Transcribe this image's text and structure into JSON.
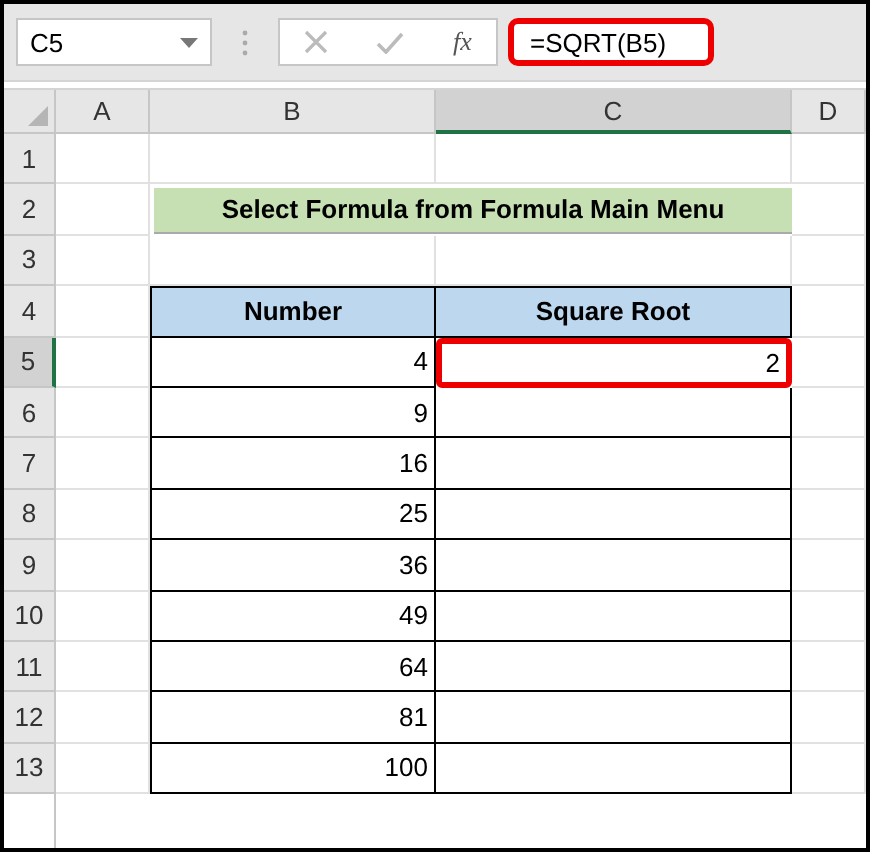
{
  "formula_bar": {
    "name_box": "C5",
    "function_label": "fx",
    "formula": "=SQRT(B5)",
    "highlighted": true
  },
  "columns": [
    {
      "label": "A",
      "selected": false
    },
    {
      "label": "B",
      "selected": false
    },
    {
      "label": "C",
      "selected": true
    },
    {
      "label": "D",
      "selected": false
    }
  ],
  "rows": [
    {
      "number": "1",
      "selected": false,
      "kind": "empty"
    },
    {
      "number": "2",
      "selected": false,
      "kind": "title",
      "text": "Select Formula from Formula Main Menu"
    },
    {
      "number": "3",
      "selected": false,
      "kind": "empty"
    },
    {
      "number": "4",
      "selected": false,
      "kind": "table_header",
      "cells": [
        "Number",
        "Square Root"
      ]
    },
    {
      "number": "5",
      "selected": true,
      "kind": "table_row",
      "cells": [
        "4",
        "2"
      ],
      "active_cell": true
    },
    {
      "number": "6",
      "selected": false,
      "kind": "table_row",
      "cells": [
        "9",
        ""
      ],
      "active_cell": false
    },
    {
      "number": "7",
      "selected": false,
      "kind": "table_row",
      "cells": [
        "16",
        ""
      ],
      "active_cell": false
    },
    {
      "number": "8",
      "selected": false,
      "kind": "table_row",
      "cells": [
        "25",
        ""
      ],
      "active_cell": false
    },
    {
      "number": "9",
      "selected": false,
      "kind": "table_row",
      "cells": [
        "36",
        ""
      ],
      "active_cell": false
    },
    {
      "number": "10",
      "selected": false,
      "kind": "table_row",
      "cells": [
        "49",
        ""
      ],
      "active_cell": false
    },
    {
      "number": "11",
      "selected": false,
      "kind": "table_row",
      "cells": [
        "64",
        ""
      ],
      "active_cell": false
    },
    {
      "number": "12",
      "selected": false,
      "kind": "table_row",
      "cells": [
        "81",
        ""
      ],
      "active_cell": false
    },
    {
      "number": "13",
      "selected": false,
      "kind": "table_row",
      "cells": [
        "100",
        ""
      ],
      "active_cell": false
    }
  ]
}
